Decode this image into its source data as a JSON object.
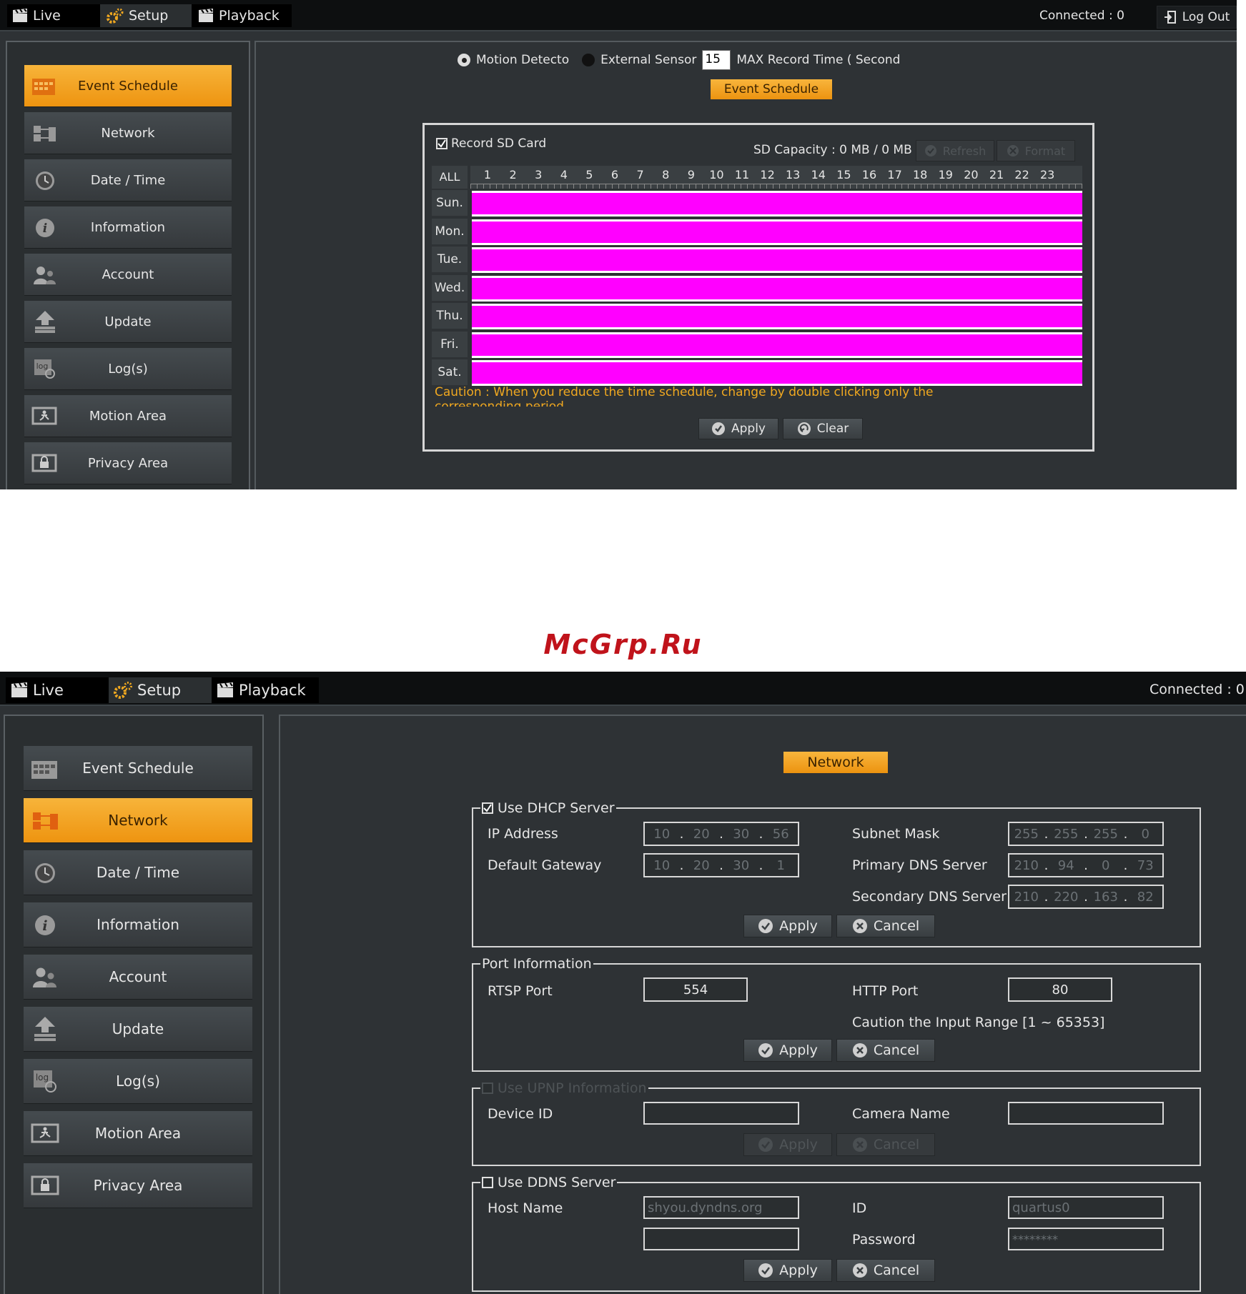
{
  "tabs": {
    "live": "Live",
    "setup": "Setup",
    "playback": "Playback"
  },
  "status": {
    "connected": "Connected : 0",
    "logout": "Log Out"
  },
  "menu": [
    "Event Schedule",
    "Network",
    "Date / Time",
    "Information",
    "Account",
    "Update",
    "Log(s)",
    "Motion Area",
    "Privacy Area"
  ],
  "event": {
    "radio_motion": "Motion Detecto",
    "radio_sensor": "External Sensor",
    "max_record_value": "15",
    "max_record_label": "MAX Record Time ( Second",
    "title_button": "Event Schedule",
    "record_sd": "Record SD Card",
    "sd_capacity": "SD Capacity : 0 MB / 0 MB",
    "refresh": "Refresh",
    "format": "Format",
    "all": "ALL",
    "hours": [
      "1",
      "2",
      "3",
      "4",
      "5",
      "6",
      "7",
      "8",
      "9",
      "10",
      "11",
      "12",
      "13",
      "14",
      "15",
      "16",
      "17",
      "18",
      "19",
      "20",
      "21",
      "22",
      "23"
    ],
    "days": [
      "Sun.",
      "Mon.",
      "Tue.",
      "Wed.",
      "Thu.",
      "Fri.",
      "Sat."
    ],
    "caution": "Caution : When you reduce the time schedule, change by double clicking only the",
    "caution2": "corresponding period.",
    "apply": "Apply",
    "clear": "Clear"
  },
  "watermark": "McGrp.Ru",
  "network": {
    "title_button": "Network",
    "dhcp": {
      "legend": "Use DHCP Server",
      "ip_label": "IP Address",
      "ip": [
        "10",
        "20",
        "30",
        "56"
      ],
      "gateway_label": "Default Gateway",
      "gateway": [
        "10",
        "20",
        "30",
        "1"
      ],
      "subnet_label": "Subnet Mask",
      "subnet": [
        "255",
        "255",
        "255",
        "0"
      ],
      "dns1_label": "Primary DNS Server",
      "dns1": [
        "210",
        "94",
        "0",
        "73"
      ],
      "dns2_label": "Secondary DNS Server",
      "dns2": [
        "210",
        "220",
        "163",
        "82"
      ],
      "apply": "Apply",
      "cancel": "Cancel"
    },
    "port": {
      "legend": "Port Information",
      "rtsp_label": "RTSP Port",
      "rtsp": "554",
      "http_label": "HTTP Port",
      "http": "80",
      "caution": "Caution the Input Range [1 ~ 65353]",
      "apply": "Apply",
      "cancel": "Cancel"
    },
    "upnp": {
      "legend": "Use UPNP Information",
      "device_label": "Device ID",
      "device": "",
      "camera_label": "Camera Name",
      "camera": "",
      "apply": "Apply",
      "cancel": "Cancel"
    },
    "ddns": {
      "legend": "Use DDNS Server",
      "host_label": "Host Name",
      "host": "shyou.dyndns.org",
      "id_label": "ID",
      "id": "quartus0",
      "password_label": "Password",
      "password": "********",
      "apply": "Apply",
      "cancel": "Cancel"
    }
  },
  "colors": {
    "accent": "#f0a820",
    "schedule": "#ff00ff",
    "caution": "#f0a820"
  }
}
